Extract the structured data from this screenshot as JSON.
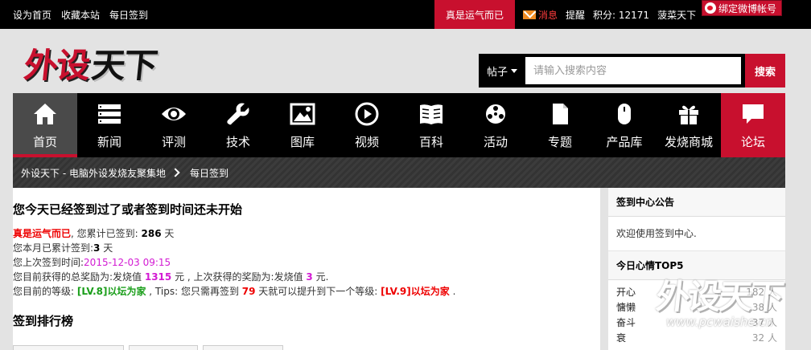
{
  "topbar": {
    "links": [
      "设为首页",
      "收藏本站",
      "每日签到"
    ],
    "username": "真是运气而已",
    "message": "消息",
    "remind": "提醒",
    "points_label": "积分: 12171",
    "site_short": "菠菜天下",
    "weibo": "绑定微博帐号"
  },
  "logo": {
    "part1": "外设",
    "part2": "天下"
  },
  "search": {
    "type": "帖子",
    "placeholder": "请输入搜索内容",
    "button": "搜索"
  },
  "nav": [
    {
      "label": "首页",
      "icon": "home-icon"
    },
    {
      "label": "新闻",
      "icon": "news-list-icon"
    },
    {
      "label": "评测",
      "icon": "eye-icon"
    },
    {
      "label": "技术",
      "icon": "wrench-icon"
    },
    {
      "label": "图库",
      "icon": "picture-icon"
    },
    {
      "label": "视频",
      "icon": "play-icon"
    },
    {
      "label": "百科",
      "icon": "book-icon"
    },
    {
      "label": "活动",
      "icon": "activity-icon"
    },
    {
      "label": "专题",
      "icon": "document-icon"
    },
    {
      "label": "产品库",
      "icon": "mouse-icon"
    },
    {
      "label": "发烧商城",
      "icon": "gift-icon"
    },
    {
      "label": "论坛",
      "icon": "chat-bubble-icon"
    }
  ],
  "breadcrumb": {
    "home": "外设天下 - 电脑外设发烧友聚集地",
    "current": "每日签到"
  },
  "signin": {
    "heading": "您今天已经签到过了或者签到时间还未开始",
    "user": "真是运气而已",
    "total_prefix": ", 您累计已签到: ",
    "total_days": "286",
    "day_unit": " 天",
    "month_prefix": "您本月已累计签到:",
    "month_days": "3",
    "month_unit": " 天",
    "last_prefix": "您上次签到时间:",
    "last_time": "2015-12-03 09:15",
    "reward_prefix": "您目前获得的总奖励为:发烧值 ",
    "reward_total": "1315",
    "reward_mid": " 元 , 上次获得的奖励为:发烧值 ",
    "reward_last": "3",
    "reward_suffix": " 元.",
    "level_prefix": "您目前的等级: ",
    "level_current": "[LV.8]以坛为家",
    "level_mid": " , Tips: 您只需再签到 ",
    "level_days": "79",
    "level_mid2": " 天就可以提升到下一个等级: ",
    "level_next": "[LV.9]以坛为家",
    "level_suffix": " .",
    "ranking_heading": "签到排行榜"
  },
  "sidebar": {
    "notice_title": "签到中心公告",
    "notice_body": "欢迎使用签到中心.",
    "mood_title": "今日心情TOP5",
    "moods": [
      {
        "name": "开心",
        "count": "182 人"
      },
      {
        "name": "慵懒",
        "count": "38 人"
      },
      {
        "name": "奋斗",
        "count": "37 人"
      },
      {
        "name": "衰",
        "count": "32 人"
      }
    ]
  },
  "watermark": {
    "text": "外设天下",
    "url": "www.pcwaishe.cn"
  },
  "colors": {
    "brand_red": "#c8102e",
    "nav_bg": "#000000",
    "active_bg": "#4a4a4a"
  }
}
